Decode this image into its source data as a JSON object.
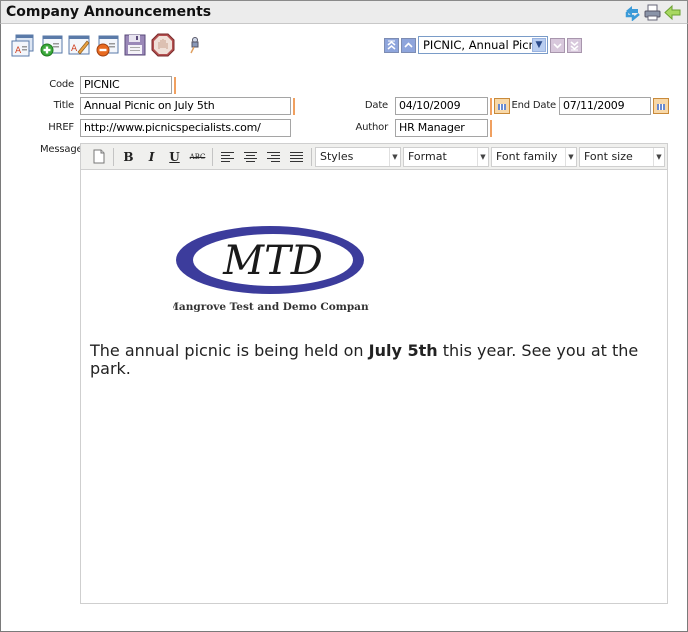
{
  "header": {
    "title": "Company Announcements",
    "icons": [
      "refresh-icon",
      "print-icon",
      "back-arrow-icon"
    ]
  },
  "toolbar": {
    "buttons": [
      {
        "name": "list-records-button",
        "icon": "list-records-icon"
      },
      {
        "name": "add-record-button",
        "icon": "add-record-icon"
      },
      {
        "name": "edit-record-button",
        "icon": "edit-record-icon"
      },
      {
        "name": "delete-record-button",
        "icon": "delete-record-icon"
      },
      {
        "name": "save-button",
        "icon": "save-icon"
      },
      {
        "name": "stop-button",
        "icon": "stop-hand-icon"
      },
      {
        "name": "pin-button",
        "icon": "pin-icon"
      }
    ]
  },
  "navigation": {
    "selected_record": "PICNIC, Annual Picnic",
    "buttons": [
      "first-record",
      "previous-record",
      "next-record",
      "last-record"
    ]
  },
  "form": {
    "code": {
      "label": "Code",
      "value": "PICNIC"
    },
    "title": {
      "label": "Title",
      "value": "Annual Picnic on July 5th"
    },
    "href": {
      "label": "HREF",
      "value": "http://www.picnicspecialists.com/"
    },
    "date": {
      "label": "Date",
      "value": "04/10/2009"
    },
    "end_date": {
      "label": "End Date",
      "value": "07/11/2009"
    },
    "author": {
      "label": "Author",
      "value": "HR Manager"
    },
    "message": {
      "label": "Message"
    }
  },
  "editor": {
    "buttons": {
      "bold": "B",
      "italic": "I",
      "underline": "U",
      "strike": "ABC"
    },
    "dropdowns": {
      "styles": "Styles",
      "format": "Format",
      "font_family": "Font family",
      "font_size": "Font size"
    },
    "logo": {
      "monogram": "MTD",
      "company": "Mangrove Test and Demo Company"
    },
    "body": {
      "before": "The annual picnic is being held on ",
      "bold": "July 5th",
      "after": " this year. See you at the park."
    }
  },
  "colors": {
    "required_marker": "#f0a060",
    "logo_ring": "#3b3b9a",
    "header_bg": "#ececec"
  }
}
